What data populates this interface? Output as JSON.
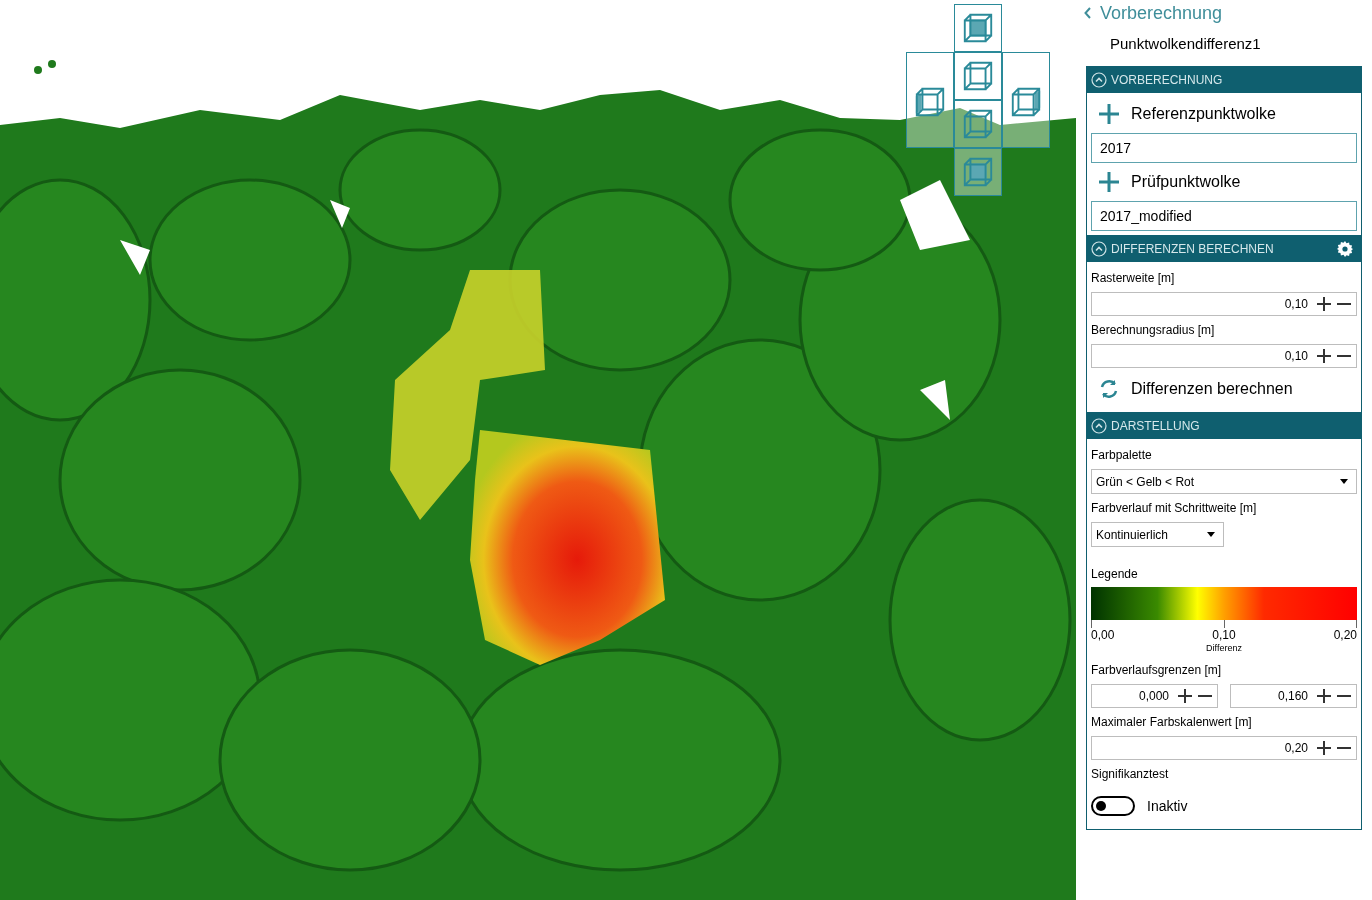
{
  "nav": {
    "back_label": "Vorberechnung",
    "title": "Punktwolkendifferenz1"
  },
  "sections": [
    {
      "title": "VORBERECHNUNG",
      "expanded": true,
      "settings_button": false,
      "items": [
        {
          "kind": "add",
          "label": "Referenzpunktwolke"
        },
        {
          "kind": "field",
          "value": "2017"
        },
        {
          "kind": "add",
          "label": "Prüfpunktwolke"
        },
        {
          "kind": "field",
          "value": "2017_modified"
        }
      ]
    },
    {
      "title": "DIFFERENZEN BERECHNEN",
      "expanded": true,
      "settings_button": true,
      "items": [
        {
          "kind": "label",
          "label": "Rasterweite [m]"
        },
        {
          "kind": "spinner",
          "value": "0,10"
        },
        {
          "kind": "label",
          "label": "Berechnungsradius [m]"
        },
        {
          "kind": "spinner",
          "value": "0,10"
        },
        {
          "kind": "action",
          "label": "Differenzen berechnen"
        }
      ]
    },
    {
      "title": "DARSTELLUNG",
      "expanded": true,
      "settings_button": false,
      "items": [
        {
          "kind": "label",
          "label": "Farbpalette"
        },
        {
          "kind": "dropdown",
          "value": "Grün < Gelb < Rot",
          "full_width": true
        },
        {
          "kind": "label",
          "label": "Farbverlauf mit Schrittweite [m]"
        },
        {
          "kind": "dropdown",
          "value": "Kontinuierlich",
          "full_width": false
        },
        {
          "kind": "legend",
          "label": "Legende",
          "ticks": [
            "0,00",
            "0,10",
            "0,20"
          ],
          "caption": "Differenz"
        },
        {
          "kind": "label",
          "label": "Farbverlaufsgrenzen [m]"
        },
        {
          "kind": "spinner_pair",
          "values": [
            "0,000",
            "0,160"
          ]
        },
        {
          "kind": "label",
          "label": "Maximaler Farbskalenwert [m]"
        },
        {
          "kind": "spinner",
          "value": "0,20"
        },
        {
          "kind": "label",
          "label": "Signifikanztest"
        },
        {
          "kind": "toggle",
          "on": false,
          "label": "Inaktiv"
        }
      ]
    }
  ]
}
